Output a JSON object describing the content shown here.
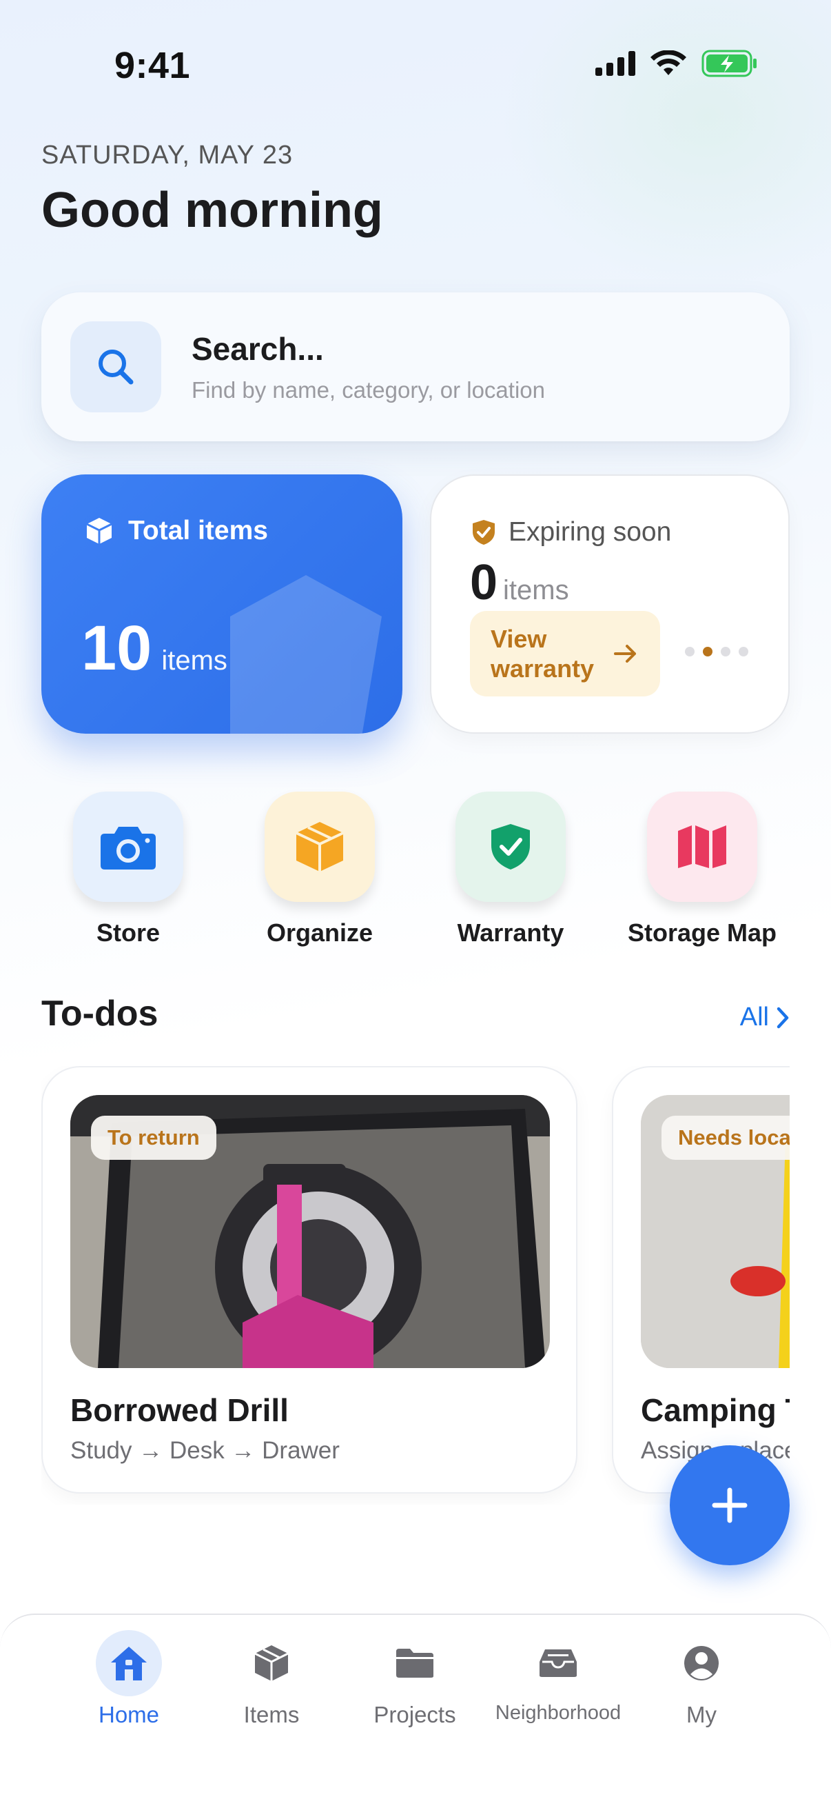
{
  "status_bar": {
    "time": "9:41",
    "icons": [
      "signal-icon",
      "wifi-icon",
      "battery-charging-icon"
    ]
  },
  "header": {
    "date": "SATURDAY, MAY 23",
    "greeting": "Good morning"
  },
  "search": {
    "title": "Search...",
    "placeholder": "Find by name, category, or location"
  },
  "stats": {
    "total": {
      "label": "Total items",
      "count": "10",
      "unit": "items",
      "color": "#2d6ee8"
    },
    "expiring": {
      "label": "Expiring soon",
      "count": "0",
      "unit": "items",
      "action": "View warranty",
      "page_dots": 4,
      "active_dot": 1,
      "accent": "#b9741b"
    }
  },
  "quick_actions": [
    {
      "label": "Store",
      "icon": "camera-icon",
      "color": "#1a73e8"
    },
    {
      "label": "Organize",
      "icon": "box-icon",
      "color": "#f5a623"
    },
    {
      "label": "Warranty",
      "icon": "shield-check-icon",
      "color": "#12a16b"
    },
    {
      "label": "Storage Map",
      "icon": "map-icon",
      "color": "#e8395f"
    }
  ],
  "todos": {
    "title": "To-dos",
    "all_label": "All",
    "items": [
      {
        "tag": "To return",
        "name": "Borrowed Drill",
        "path": "Study → Desk → Drawer"
      },
      {
        "tag": "Needs location",
        "name": "Camping Tent",
        "path": "Assign a place"
      }
    ]
  },
  "tabbar": {
    "active": "Home",
    "tabs": [
      {
        "label": "Home",
        "icon": "home-icon"
      },
      {
        "label": "Items",
        "icon": "box-icon"
      },
      {
        "label": "Projects",
        "icon": "folder-icon"
      },
      {
        "label": "Neighborhood",
        "icon": "inbox-icon"
      },
      {
        "label": "My",
        "icon": "person-icon"
      }
    ]
  }
}
